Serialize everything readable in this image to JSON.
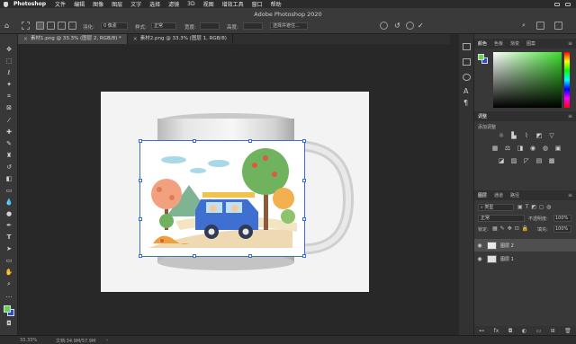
{
  "menubar": {
    "app_name": "Photoshop",
    "items": [
      "文件",
      "编辑",
      "图像",
      "图层",
      "文字",
      "选择",
      "滤镜",
      "3D",
      "视图",
      "增效工具",
      "窗口",
      "帮助"
    ]
  },
  "window_title": "Adobe Photoshop 2020",
  "options": {
    "feather_label": "羽化:",
    "feather_value": "0 像素",
    "style_label": "样式:",
    "style_value": "正常",
    "width_label": "宽度:",
    "height_label": "高度:",
    "select_mask_button": "选择并遮住..."
  },
  "tabs": [
    {
      "label": "素材1.png @ 33.3% (图层 2, RGB/8) *",
      "active": true
    },
    {
      "label": "素材2.png @ 33.3% (图层 1, RGB/8)",
      "active": false
    }
  ],
  "panels": {
    "color_tabs": [
      "颜色",
      "色板",
      "渐变",
      "图案"
    ],
    "adjust_tab": "调整",
    "adjust_add": "添加调整",
    "layers_tabs": [
      "图层",
      "通道",
      "路径"
    ],
    "kind_label": "类型",
    "blend_mode": "正常",
    "opacity_label": "不透明度:",
    "opacity_value": "100%",
    "lock_label": "锁定:",
    "fill_label": "填充:",
    "fill_value": "100%",
    "layers": [
      {
        "name": "图层 2"
      },
      {
        "name": "图层 1"
      }
    ]
  },
  "status": {
    "zoom": "33.33%",
    "doc_info": "文档:34.9M/57.9M"
  },
  "colors": {
    "foreground": "#5fd650",
    "background": "#2a4cd4",
    "selection": "#3b6fd8"
  }
}
